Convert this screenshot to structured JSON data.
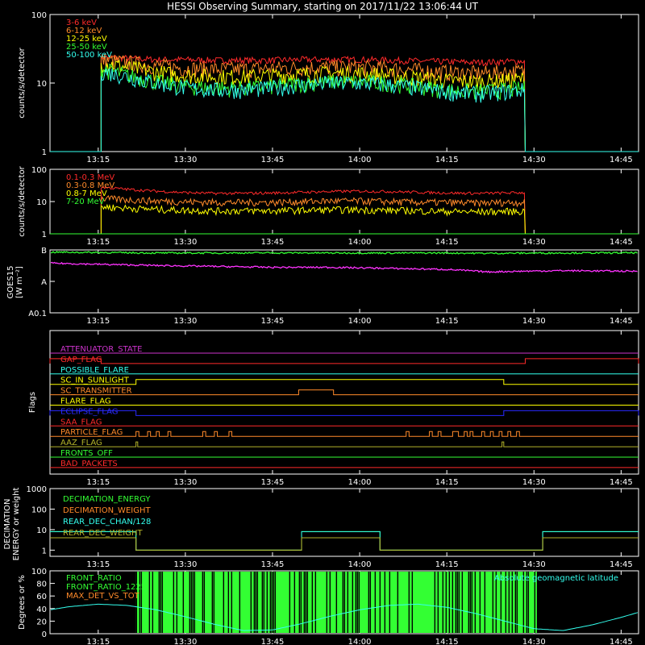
{
  "title": "HESSI Observing Summary, starting on 2017/11/22 13:06:44 UT",
  "time_axis": {
    "start": "13:06:44",
    "end": "14:48",
    "tick_labels": [
      "13:15",
      "13:30",
      "13:45",
      "14:00",
      "14:15",
      "14:30",
      "14:45"
    ],
    "tick_minutes": [
      795,
      810,
      825,
      840,
      855,
      870,
      885
    ],
    "range_minutes": [
      786.7,
      888
    ]
  },
  "colors": {
    "background": "#000000",
    "frame": "#ffffff",
    "red": "#ff2a2a",
    "orange": "#ff8a2a",
    "yellow": "#ffff00",
    "green": "#33ff33",
    "cyan": "#33ffee",
    "magenta": "#ff33ff",
    "blue": "#2a2aff",
    "olive": "#b4b42a",
    "purple": "#cc33cc"
  },
  "chart_data": [
    {
      "type": "line",
      "panel": "low_energy",
      "ylabel": "counts/s/detector",
      "yscale": "log",
      "ylim": [
        1,
        100
      ],
      "ytick_labels": [
        "1",
        "10",
        "100"
      ],
      "data_window_minutes": [
        795.5,
        868.5
      ],
      "x": [
        795.5,
        800,
        805,
        810,
        815,
        820,
        825,
        830,
        835,
        840,
        845,
        850,
        855,
        860,
        865,
        868.5
      ],
      "series": [
        {
          "name": "3-6 keV",
          "color": "red",
          "values": [
            24,
            23,
            22,
            22,
            21.5,
            21.5,
            21.5,
            22,
            22,
            22,
            21.5,
            21,
            20.5,
            20,
            20.5,
            21
          ]
        },
        {
          "name": "6-12 keV",
          "color": "orange",
          "values": [
            22,
            20,
            18,
            16.5,
            16,
            16,
            16.5,
            17,
            17,
            17,
            16.5,
            15.5,
            14.5,
            14,
            14.5,
            15
          ]
        },
        {
          "name": "12-25 keV",
          "color": "yellow",
          "values": [
            20,
            17,
            14.5,
            13,
            12.5,
            12.5,
            13,
            13.5,
            14,
            14,
            13,
            12,
            11,
            10.5,
            11,
            11.5
          ]
        },
        {
          "name": "25-50 keV",
          "color": "green",
          "values": [
            16,
            13,
            10.5,
            9,
            8.5,
            8.5,
            9,
            10,
            10.5,
            10.5,
            10,
            9,
            8,
            7.5,
            8,
            8.5
          ]
        },
        {
          "name": "50-100 keV",
          "color": "cyan",
          "values": [
            15,
            12.5,
            10,
            8.5,
            8,
            8,
            8.5,
            9.5,
            10,
            10,
            9.5,
            8.5,
            7.5,
            7,
            7.5,
            8
          ]
        }
      ]
    },
    {
      "type": "line",
      "panel": "high_energy",
      "ylabel": "counts/s/detector",
      "yscale": "log",
      "ylim": [
        1,
        100
      ],
      "ytick_labels": [
        "1",
        "10",
        "100"
      ],
      "data_window_minutes": [
        795.5,
        868.5
      ],
      "x": [
        795.5,
        800,
        805,
        810,
        815,
        820,
        825,
        830,
        835,
        840,
        845,
        850,
        855,
        860,
        865,
        868.5
      ],
      "series": [
        {
          "name": "0.1-0.3 MeV",
          "color": "red",
          "values": [
            28,
            24,
            21,
            19,
            18,
            18,
            18.5,
            19.5,
            20.5,
            21,
            20.5,
            19.5,
            18.5,
            18,
            18.5,
            19
          ]
        },
        {
          "name": "0.3-0.8 MeV",
          "color": "orange",
          "values": [
            12.5,
            11.5,
            10.5,
            10,
            9.5,
            9.5,
            9.5,
            10,
            10.5,
            10.5,
            10,
            9.5,
            9.5,
            9,
            9.5,
            9.5
          ]
        },
        {
          "name": "0.8-7 MeV",
          "color": "yellow",
          "values": [
            7,
            6.3,
            5.8,
            5.4,
            5.2,
            5.2,
            5.2,
            5.4,
            5.6,
            5.6,
            5.4,
            5.2,
            5,
            4.8,
            5,
            5
          ]
        },
        {
          "name": "7-20 MeV",
          "color": "green",
          "values": [
            1,
            1,
            1,
            1,
            1,
            1,
            1,
            1,
            1,
            1,
            1,
            1,
            1,
            1,
            1,
            1
          ]
        }
      ]
    },
    {
      "type": "line",
      "panel": "goes",
      "ylabel": "GOES15",
      "ylabel_unit": "[W m⁻²]",
      "yscale": "log",
      "ylim": [
        1e-09,
        1e-07
      ],
      "ytick_labels": [
        "A0.1",
        "A",
        "B"
      ],
      "x": [
        786.7,
        795,
        805,
        815,
        825,
        835,
        845,
        855,
        862,
        867,
        875,
        888
      ],
      "series": [
        {
          "color": "green",
          "values": [
            8.5e-08,
            8.3e-08,
            8e-08,
            8e-08,
            8.1e-08,
            8e-08,
            8e-08,
            8e-08,
            7.8e-08,
            7.9e-08,
            8e-08,
            8.1e-08
          ]
        },
        {
          "color": "magenta",
          "values": [
            3.8e-08,
            3.5e-08,
            3.2e-08,
            3e-08,
            2.8e-08,
            2.8e-08,
            2.6e-08,
            2.4e-08,
            2e-08,
            2.1e-08,
            2.2e-08,
            2.1e-08
          ]
        }
      ]
    },
    {
      "type": "line",
      "panel": "flags",
      "ylabel": "Flags",
      "flags": [
        {
          "name": "ATTENUATOR_STATE",
          "color": "purple",
          "segments": []
        },
        {
          "name": "GAP_FLAG",
          "color": "red",
          "segments": [
            [
              786.7,
              795.5
            ],
            [
              868.5,
              888
            ]
          ]
        },
        {
          "name": "POSSIBLE_FLARE",
          "color": "cyan",
          "segments": []
        },
        {
          "name": "SC_IN_SUNLIGHT",
          "color": "yellow",
          "segments": [
            [
              801.5,
              864.8
            ]
          ]
        },
        {
          "name": "SC_TRANSMITTER",
          "color": "orange",
          "segments": [
            [
              829.5,
              835.5
            ]
          ]
        },
        {
          "name": "FLARE_FLAG",
          "color": "yellow",
          "segments": []
        },
        {
          "name": "ECLIPSE_FLAG",
          "color": "blue",
          "segments": [
            [
              786.7,
              801.5
            ],
            [
              864.8,
              888
            ]
          ]
        },
        {
          "name": "SAA_FLAG",
          "color": "red",
          "segments": []
        },
        {
          "name": "PARTICLE_FLAG",
          "color": "orange",
          "segments": [
            [
              801.5,
              802
            ],
            [
              803.5,
              804
            ],
            [
              805,
              805.5
            ],
            [
              807,
              807.5
            ],
            [
              813,
              813.5
            ],
            [
              815,
              815.5
            ],
            [
              817.5,
              818
            ],
            [
              848,
              848.5
            ],
            [
              852,
              852.5
            ],
            [
              853.5,
              854
            ],
            [
              856,
              857
            ],
            [
              858,
              858.5
            ],
            [
              859,
              859.5
            ],
            [
              861,
              861.5
            ],
            [
              862.5,
              863
            ],
            [
              864,
              864.5
            ],
            [
              865.5,
              866
            ],
            [
              867,
              867.5
            ]
          ]
        },
        {
          "name": "AAZ_FLAG",
          "color": "olive",
          "segments": [
            [
              801.5,
              801.8
            ],
            [
              864.5,
              864.8
            ]
          ]
        },
        {
          "name": "FRONTS_OFF",
          "color": "green",
          "segments": []
        },
        {
          "name": "BAD_PACKETS",
          "color": "red",
          "segments": []
        }
      ]
    },
    {
      "type": "line",
      "panel": "decimation",
      "ylabel": "DECIMATION",
      "ylabel2": "ENERGY or weight",
      "yscale": "log",
      "ylim": [
        0.5,
        1000
      ],
      "ytick_labels": [
        "1",
        "10",
        "100",
        "1000"
      ],
      "series": [
        {
          "name": "DECIMATION_ENERGY",
          "color": "green",
          "steps": [
            [
              786.7,
              801.5,
              8
            ],
            [
              801.5,
              830,
              1
            ],
            [
              830,
              843.5,
              8
            ],
            [
              843.5,
              871.5,
              1
            ],
            [
              871.5,
              888,
              8
            ]
          ]
        },
        {
          "name": "DECIMATION_WEIGHT",
          "color": "orange",
          "steps": [
            [
              786.7,
              801.5,
              4
            ],
            [
              801.5,
              830,
              1
            ],
            [
              830,
              843.5,
              4
            ],
            [
              843.5,
              871.5,
              1
            ],
            [
              871.5,
              888,
              4
            ]
          ]
        },
        {
          "name": "REAR_DEC_CHAN/128",
          "color": "cyan",
          "steps": [
            [
              786.7,
              801.5,
              8
            ],
            [
              801.5,
              830,
              1
            ],
            [
              830,
              843.5,
              8
            ],
            [
              843.5,
              871.5,
              1
            ],
            [
              871.5,
              888,
              8
            ]
          ]
        },
        {
          "name": "REAR_DEC_WEIGHT",
          "color": "olive",
          "steps": [
            [
              786.7,
              801.5,
              4
            ],
            [
              801.5,
              830,
              1
            ],
            [
              830,
              843.5,
              4
            ],
            [
              843.5,
              871.5,
              1
            ],
            [
              871.5,
              888,
              4
            ]
          ]
        }
      ]
    },
    {
      "type": "line",
      "panel": "ratios",
      "ylabel": "Degrees or %",
      "ylim": [
        0,
        100
      ],
      "ytick_labels": [
        "0",
        "20",
        "40",
        "60",
        "80",
        "100"
      ],
      "annotation": "Absolute geomagnetic latitude",
      "series": [
        {
          "name": "FRONT_RATIO",
          "color": "green"
        },
        {
          "name": "FRONT_RATIO_1225",
          "color": "green"
        },
        {
          "name": "MAX_DET_VS_TOT",
          "color": "orange"
        }
      ],
      "latitude": {
        "x": [
          786.7,
          790,
          795,
          800,
          805,
          810,
          815,
          820,
          825,
          830,
          835,
          840,
          845,
          850,
          855,
          860,
          865,
          870,
          875,
          880,
          885,
          888
        ],
        "values": [
          38,
          43,
          47,
          45,
          38,
          27,
          15,
          5,
          6,
          16,
          28,
          38,
          45,
          47,
          42,
          32,
          20,
          8,
          5,
          14,
          26,
          34
        ]
      },
      "ratio_window_minutes": [
        801.5,
        870.5
      ]
    }
  ]
}
